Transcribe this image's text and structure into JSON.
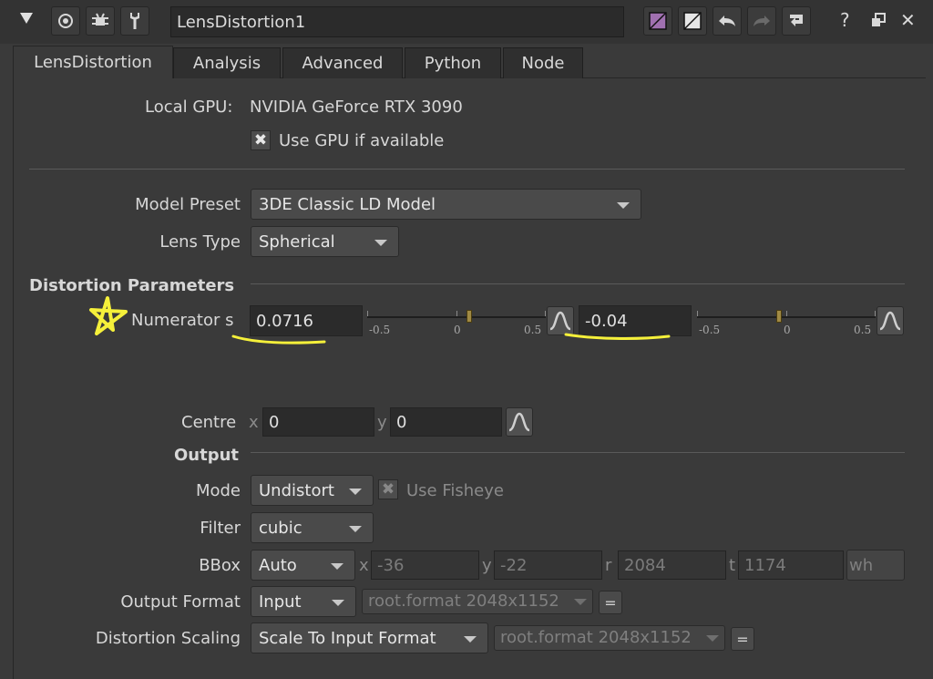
{
  "titlebar": {
    "node_name": "LensDistortion1",
    "icons": [
      "collapse-triangle-icon",
      "viewer-icon",
      "bug-icon",
      "wrench-icon",
      "color-swatch-icon",
      "swatch-icon",
      "undo-icon",
      "redo-icon",
      "revert-icon",
      "help-icon",
      "float-icon",
      "close-icon"
    ],
    "help": "?",
    "close": "✕"
  },
  "tabs": [
    {
      "label": "LensDistortion",
      "active": true
    },
    {
      "label": "Analysis"
    },
    {
      "label": "Advanced"
    },
    {
      "label": "Python"
    },
    {
      "label": "Node"
    }
  ],
  "gpu": {
    "label": "Local GPU:",
    "value": "NVIDIA GeForce RTX 3090",
    "use_gpu_label": "Use GPU if available",
    "use_gpu_checked": true
  },
  "model": {
    "preset_label": "Model Preset",
    "preset_value": "3DE Classic LD Model",
    "lens_type_label": "Lens Type",
    "lens_type_value": "Spherical"
  },
  "distortion": {
    "section_label": "Distortion Parameters",
    "numerator_label": "Numerator s",
    "value1": "0.0716",
    "value2": "-0.04",
    "slider_ticks": [
      "-0.5",
      "0",
      "0.5"
    ],
    "slider1_value": 0.0716,
    "slider2_value": -0.04
  },
  "centre": {
    "label": "Centre",
    "x_label": "x",
    "x_value": "0",
    "y_label": "y",
    "y_value": "0"
  },
  "output": {
    "section_label": "Output",
    "mode_label": "Mode",
    "mode_value": "Undistort",
    "fisheye_label": "Use Fisheye",
    "filter_label": "Filter",
    "filter_value": "cubic",
    "bbox_label": "BBox",
    "bbox_value": "Auto",
    "bbox_x_label": "x",
    "bbox_x": "-36",
    "bbox_y_label": "y",
    "bbox_y": "-22",
    "bbox_r_label": "r",
    "bbox_r": "2084",
    "bbox_t_label": "t",
    "bbox_t": "1174",
    "bbox_wh": "wh",
    "output_format_label": "Output Format",
    "output_format_value": "Input",
    "output_format_ref": "root.format 2048x1152",
    "eq_label": "=",
    "scaling_label": "Distortion Scaling",
    "scaling_value": "Scale To Input Format",
    "scaling_ref": "root.format 2048x1152"
  },
  "colors": {
    "annotation": "#f5f03a",
    "panel_bg": "#3a3a3a",
    "field_bg": "#2b2b2b"
  }
}
